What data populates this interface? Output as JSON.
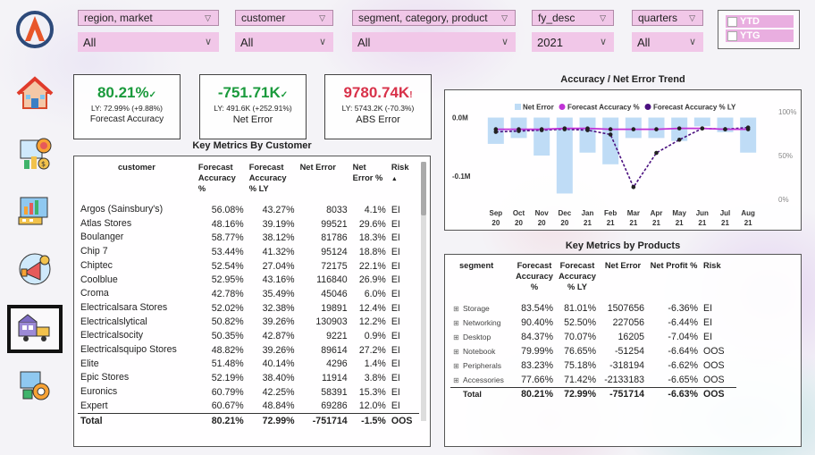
{
  "filters": [
    {
      "label": "region, market",
      "value": "All"
    },
    {
      "label": "customer",
      "value": "All"
    },
    {
      "label": "segment, category, product",
      "value": "All"
    },
    {
      "label": "fy_desc",
      "value": "2021"
    },
    {
      "label": "quarters",
      "value": "All"
    }
  ],
  "period": {
    "ytd": "YTD",
    "ytg": "YTG"
  },
  "kpis": [
    {
      "value": "80.21%",
      "mark": "✓",
      "ly": "LY: 72.99% (+9.88%)",
      "label": "Forecast Accuracy",
      "color": "#1a9a3c"
    },
    {
      "value": "-751.71K",
      "mark": "✓",
      "ly": "LY: 491.6K (+252.91%)",
      "label": "Net Error",
      "color": "#1a9a3c"
    },
    {
      "value": "9780.74K",
      "mark": "!",
      "ly": "LY: 5743.2K (-70.3%)",
      "label": "ABS Error",
      "color": "#d8324a"
    }
  ],
  "customer_table": {
    "title": "Key Metrics By Customer",
    "headers": [
      "customer",
      "Forecast Accuracy %",
      "Forecast Accuracy % LY",
      "Net Error",
      "Net Error %",
      "Risk"
    ],
    "sort_icon": "▲",
    "rows": [
      [
        "Argos (Sainsbury's)",
        "56.08%",
        "43.27%",
        "8033",
        "4.1%",
        "EI"
      ],
      [
        "Atlas Stores",
        "48.16%",
        "39.19%",
        "99521",
        "29.6%",
        "EI"
      ],
      [
        "Boulanger",
        "58.77%",
        "38.12%",
        "81786",
        "18.3%",
        "EI"
      ],
      [
        "Chip 7",
        "53.44%",
        "41.32%",
        "95124",
        "18.8%",
        "EI"
      ],
      [
        "Chiptec",
        "52.54%",
        "27.04%",
        "72175",
        "22.1%",
        "EI"
      ],
      [
        "Coolblue",
        "52.95%",
        "43.16%",
        "116840",
        "26.9%",
        "EI"
      ],
      [
        "Croma",
        "42.78%",
        "35.49%",
        "45046",
        "6.0%",
        "EI"
      ],
      [
        "Electricalsara Stores",
        "52.02%",
        "32.38%",
        "19891",
        "12.4%",
        "EI"
      ],
      [
        "Electricalslytical",
        "50.82%",
        "39.26%",
        "130903",
        "12.2%",
        "EI"
      ],
      [
        "Electricalsocity",
        "50.35%",
        "42.87%",
        "9221",
        "0.9%",
        "EI"
      ],
      [
        "Electricalsquipo Stores",
        "48.82%",
        "39.26%",
        "89614",
        "27.2%",
        "EI"
      ],
      [
        "Elite",
        "51.48%",
        "40.14%",
        "4296",
        "1.4%",
        "EI"
      ],
      [
        "Epic Stores",
        "52.19%",
        "38.40%",
        "11914",
        "3.8%",
        "EI"
      ],
      [
        "Euronics",
        "60.79%",
        "42.25%",
        "58391",
        "15.3%",
        "EI"
      ],
      [
        "Expert",
        "60.67%",
        "48.84%",
        "69286",
        "12.0%",
        "EI"
      ]
    ],
    "total": [
      "Total",
      "80.21%",
      "72.99%",
      "-751714",
      "-1.5%",
      "OOS"
    ]
  },
  "product_table": {
    "title": "Key Metrics by Products",
    "headers": [
      "segment",
      "Forecast Accuracy %",
      "Forecast Accuracy % LY",
      "Net Error",
      "Net Profit %",
      "Risk"
    ],
    "sort_icon": "▼",
    "expand_icon": "⊞",
    "rows": [
      [
        "Storage",
        "83.54%",
        "81.01%",
        "1507656",
        "-6.36%",
        "EI"
      ],
      [
        "Networking",
        "90.40%",
        "52.50%",
        "227056",
        "-6.44%",
        "EI"
      ],
      [
        "Desktop",
        "84.37%",
        "70.07%",
        "16205",
        "-7.04%",
        "EI"
      ],
      [
        "Notebook",
        "79.99%",
        "76.65%",
        "-51254",
        "-6.64%",
        "OOS"
      ],
      [
        "Peripherals",
        "83.23%",
        "75.18%",
        "-318194",
        "-6.62%",
        "OOS"
      ],
      [
        "Accessories",
        "77.66%",
        "71.42%",
        "-2133183",
        "-6.65%",
        "OOS"
      ]
    ],
    "total": [
      "Total",
      "80.21%",
      "72.99%",
      "-751714",
      "-6.63%",
      "OOS"
    ]
  },
  "chart_data": {
    "type": "bar",
    "title": "Accuracy / Net Error Trend",
    "legend": [
      "Net Error",
      "Forecast Accuracy %",
      "Forecast Accuracy % LY"
    ],
    "legend_position": "top",
    "categories": [
      "Sep 20",
      "Oct 20",
      "Nov 20",
      "Dec 20",
      "Jan 21",
      "Feb 21",
      "Mar 21",
      "Apr 21",
      "May 21",
      "Jun 21",
      "Jul 21",
      "Aug 21"
    ],
    "series": [
      {
        "name": "Net Error",
        "axis": "left",
        "values": [
          -0.045,
          -0.035,
          -0.065,
          -0.13,
          -0.06,
          -0.08,
          -0.035,
          -0.035,
          -0.04,
          -0.015,
          -0.025,
          -0.06
        ]
      },
      {
        "name": "Forecast Accuracy %",
        "axis": "right",
        "values": [
          80,
          80,
          80,
          81,
          81,
          80,
          80,
          80,
          81,
          81,
          80,
          80
        ]
      },
      {
        "name": "Forecast Accuracy % LY",
        "axis": "right",
        "values": [
          77,
          78,
          79,
          80,
          79,
          74,
          14,
          53,
          68,
          81,
          80,
          82
        ]
      }
    ],
    "yleft": {
      "ticks": [
        "0.0M",
        "-0.1M"
      ],
      "range": [
        -0.14,
        0.01
      ]
    },
    "yright": {
      "ticks": [
        "100%",
        "50%",
        "0%"
      ],
      "range": [
        0,
        100
      ]
    },
    "colors": {
      "bar": "#bfdcf6",
      "line": "#c032d6",
      "ly": "#4b1080",
      "dot": "#222"
    }
  }
}
